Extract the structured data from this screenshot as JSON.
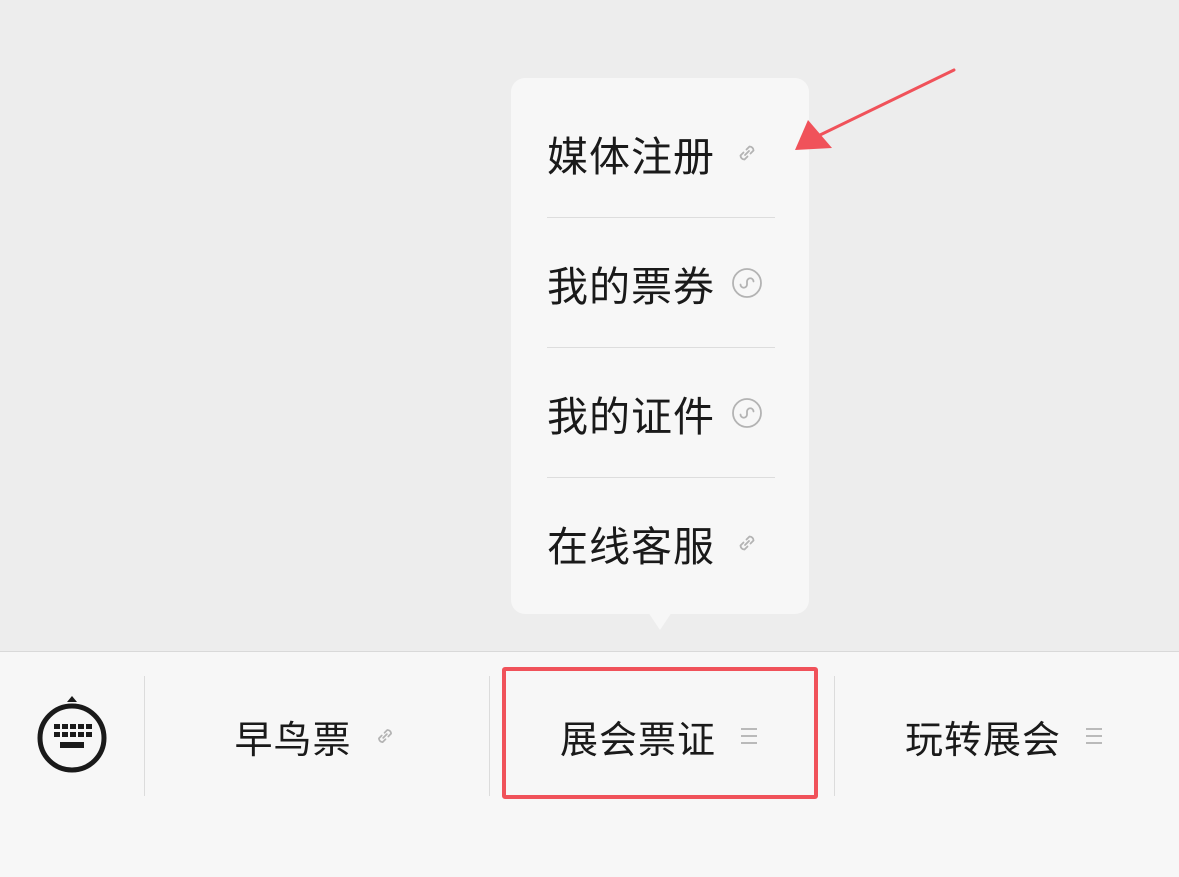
{
  "popup_menu": {
    "items": [
      {
        "label": "媒体注册",
        "icon": "link-icon"
      },
      {
        "label": "我的票券",
        "icon": "mini-program-icon"
      },
      {
        "label": "我的证件",
        "icon": "mini-program-icon"
      },
      {
        "label": "在线客服",
        "icon": "link-icon"
      }
    ]
  },
  "menu_bar": {
    "keyboard_icon": "keyboard-icon",
    "tabs": [
      {
        "label": "早鸟票",
        "icon": "link-icon"
      },
      {
        "label": "展会票证",
        "icon": "menu-icon"
      },
      {
        "label": "玩转展会",
        "icon": "menu-icon"
      }
    ]
  },
  "annotation_colors": {
    "highlight": "#f0525a",
    "arrow": "#f0525a"
  }
}
